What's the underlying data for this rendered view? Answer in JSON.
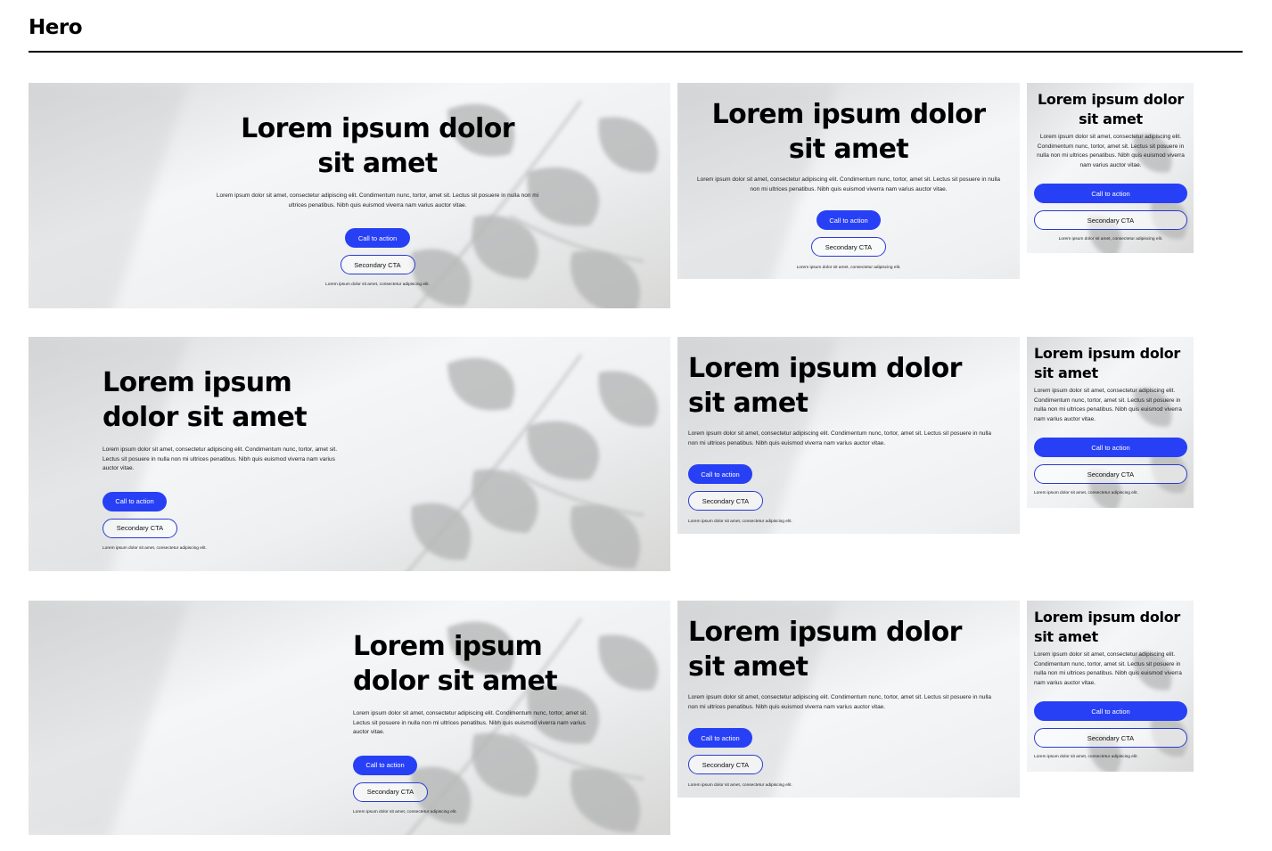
{
  "page": {
    "title": "Hero"
  },
  "hero": {
    "title": "Lorem ipsum dolor sit amet",
    "body": "Lorem ipsum dolor sit amet, consectetur adipiscing elit. Condimentum nunc, tortor, amet sit. Lectus sit posuere in nulla non mi ultrices penatibus. Nibh quis euismod viverra nam varius auctor vitae.",
    "primary_cta": "Call to action",
    "secondary_cta": "Secondary CTA",
    "fine_print": "Lorem ipsum dolor sit amet, consectetur adipiscing elit."
  },
  "colors": {
    "primary_button": "#2740f5",
    "secondary_border": "#2b3bd0",
    "frame_background": "#f2f3f4",
    "leaf_shadow": "#aeb0b1"
  },
  "variants": [
    {
      "alignment": "center",
      "size": "large"
    },
    {
      "alignment": "center",
      "size": "medium"
    },
    {
      "alignment": "center",
      "size": "small"
    },
    {
      "alignment": "left",
      "size": "large"
    },
    {
      "alignment": "left",
      "size": "medium"
    },
    {
      "alignment": "left",
      "size": "small"
    },
    {
      "alignment": "right",
      "size": "large"
    },
    {
      "alignment": "left",
      "size": "medium"
    },
    {
      "alignment": "left",
      "size": "small"
    }
  ]
}
